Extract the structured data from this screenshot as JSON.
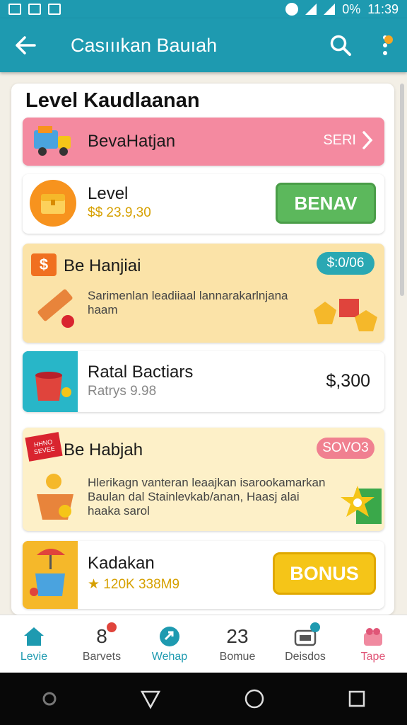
{
  "status_bar": {
    "battery_text": "0%",
    "time": "11:39"
  },
  "app_bar": {
    "title": "Casıııkan Bauıah"
  },
  "content": {
    "page_title": "Level Kaudlaanan",
    "rows": [
      {
        "title": "BevaHatjan",
        "action_label": "SERI"
      },
      {
        "title": "Level",
        "price": "$$ 23.9,30",
        "button_label": "BENAV"
      },
      {
        "title": "Be Hanjiai",
        "price_bubble": "$:0/06",
        "description": "Sarimenlan leadiiaal lannarakarlnjana haam"
      },
      {
        "title": "Ratal Bactiars",
        "subtitle": "Ratrys 9.98",
        "price": "$,300"
      },
      {
        "title": "Be Habjah",
        "ribbon_text": "HHNO SEVEE",
        "pill": "SOVO3",
        "description": "Hlerikagn vanteran leaajkan isarookamarkan Baulan dal Stainlevkab/anan, Haasj alai haaka sarol"
      },
      {
        "title": "Kadakan",
        "subtitle": "★ 120K 338M9",
        "button_label": "BONUS"
      }
    ]
  },
  "tabs": [
    {
      "label": "Levie",
      "icon": "home-icon",
      "active": true
    },
    {
      "label": "Barvets",
      "icon": "badge-8-icon"
    },
    {
      "label": "Wehap",
      "icon": "share-icon"
    },
    {
      "label": "Bomue",
      "number": "23"
    },
    {
      "label": "Deisdos",
      "icon": "tag-icon"
    },
    {
      "label": "Tape",
      "icon": "gift-icon"
    }
  ],
  "colors": {
    "primary": "#1e9ab0",
    "pink_row": "#f48aa0",
    "green_button": "#5cb85c",
    "yellow_button": "#f5c518"
  }
}
